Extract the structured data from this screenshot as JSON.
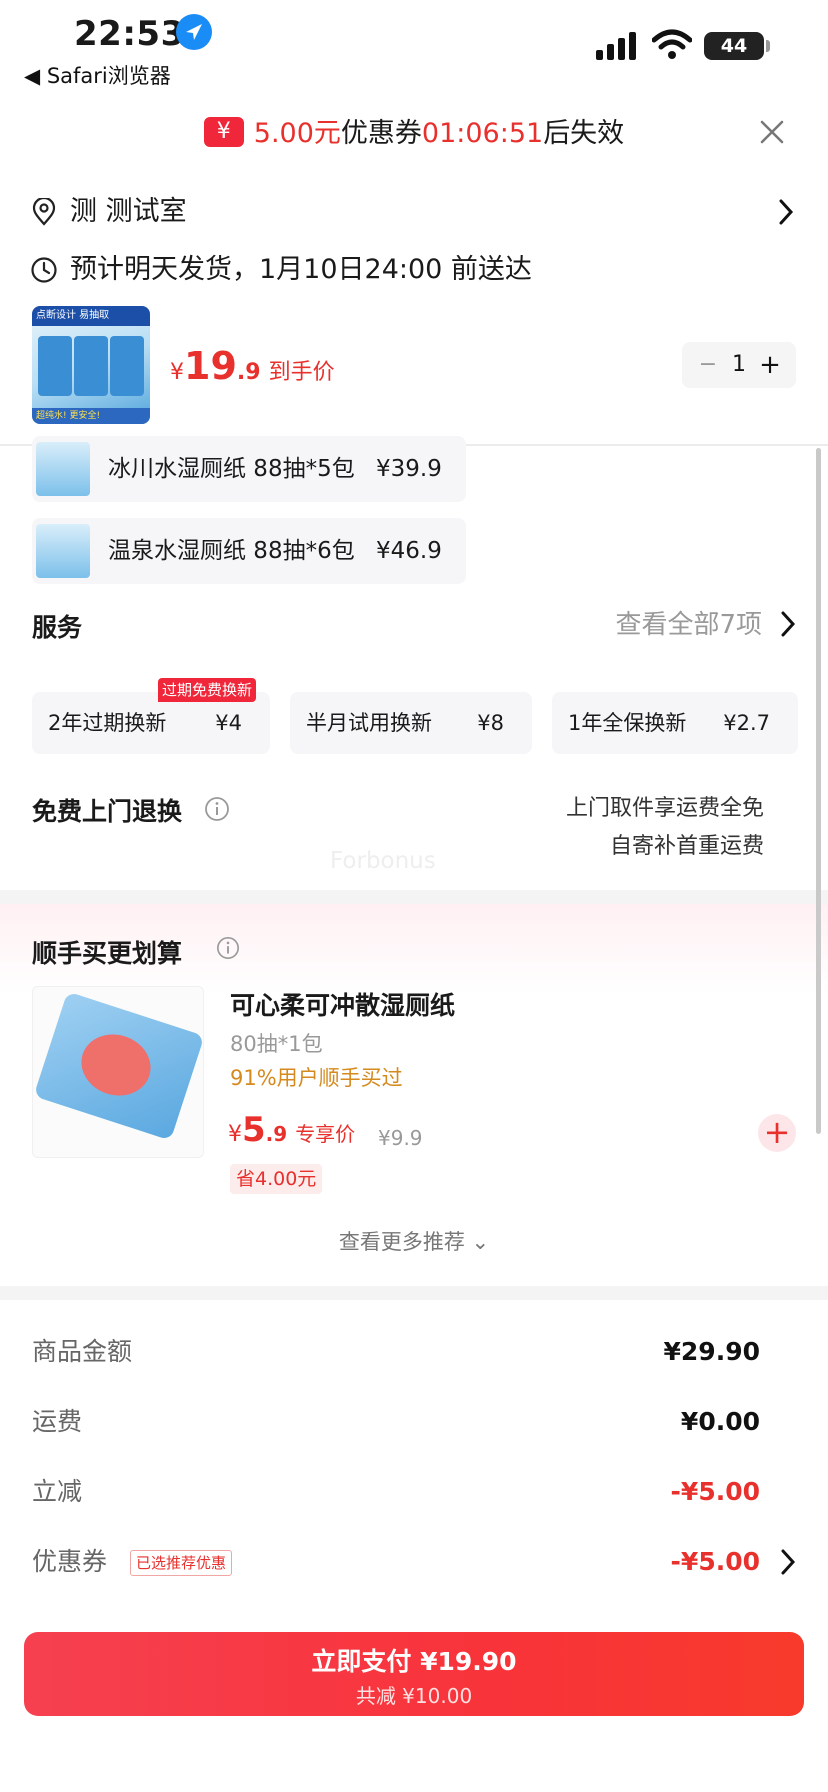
{
  "status_bar": {
    "time": "22:53",
    "back_app": "◀ Safari浏览器",
    "battery": "44"
  },
  "coupon_banner": {
    "icon": "¥",
    "amount": "5.00元",
    "label": "优惠券",
    "countdown": "01:06:51",
    "suffix": "后失效"
  },
  "address": {
    "text": "测  测试室"
  },
  "delivery": {
    "text": "预计明天发货，1月10日24:00 前送达"
  },
  "product": {
    "thumb_header": "点断设计 易抽取",
    "thumb_footer": "超纯水! 更安全!",
    "price_currency": "¥",
    "price_int": "19",
    "price_dec": ".9",
    "price_label": "到手价",
    "quantity": "1",
    "minus": "−",
    "plus": "+"
  },
  "variants": [
    {
      "name": "冰川水湿厕纸 88抽*5包",
      "price": "¥39.9"
    },
    {
      "name": "温泉水湿厕纸 88抽*6包",
      "price": "¥46.9"
    }
  ],
  "services": {
    "title": "服务",
    "view_all": "查看全部7项",
    "tag": "过期免费换新",
    "items": [
      {
        "name": "2年过期换新",
        "price": "¥4"
      },
      {
        "name": "半月试用换新",
        "price": "¥8"
      },
      {
        "name": "1年全保换新",
        "price": "¥2.7"
      }
    ]
  },
  "free_return": {
    "title": "免费上门退换",
    "note_line1": "上门取件享运费全免",
    "note_line2": "自寄补首重运费"
  },
  "watermark": "Forbonus",
  "recommend": {
    "title": "顺手买更划算",
    "item": {
      "name": "可心柔可冲散湿厕纸",
      "spec": "80抽*1包",
      "social": "91%用户顺手买过",
      "price_currency": "¥",
      "price_int": "5",
      "price_dec": ".9",
      "price_label": "专享价",
      "original_price": "¥9.9",
      "save": "省4.00元",
      "add": "+"
    },
    "see_more": "查看更多推荐 ⌄"
  },
  "summary": {
    "rows": [
      {
        "label": "商品金额",
        "value": "¥29.90"
      },
      {
        "label": "运费",
        "value": "¥0.00"
      },
      {
        "label": "立减",
        "value": "-¥5.00"
      },
      {
        "label": "优惠券",
        "value": "-¥5.00",
        "badge": "已选推荐优惠"
      }
    ]
  },
  "pay_button": {
    "main": "立即支付 ¥19.90",
    "sub": "共减 ¥10.00"
  },
  "colors": {
    "accent_red": "#e8302d",
    "pay_button": "#f83a3f",
    "social_orange": "#d58a1e"
  }
}
